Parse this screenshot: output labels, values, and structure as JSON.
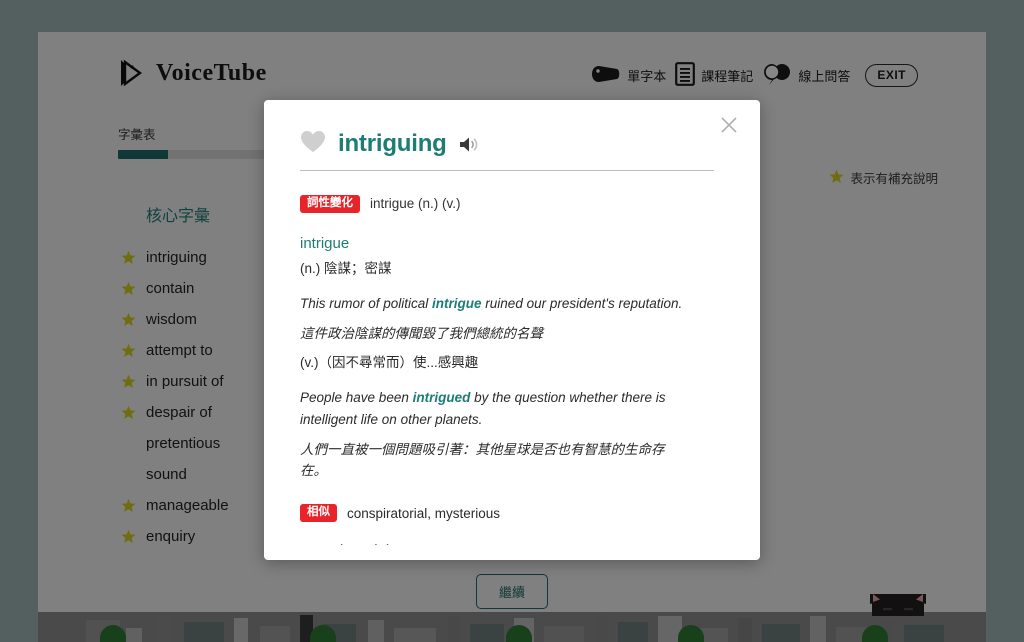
{
  "colors": {
    "page_backdrop": "#53605f",
    "accent_teal": "#1d7d75",
    "progress_teal": "#1d6b66",
    "tag_red": "#e8242a",
    "star_yellow": "#d4cf20"
  },
  "header": {
    "brand": "VoiceTube",
    "logo_icon": "voicetube-play-icon",
    "nav": [
      {
        "label": "單字本",
        "icon": "tag-icon"
      },
      {
        "label": "課程筆記",
        "icon": "document-icon"
      },
      {
        "label": "線上問答",
        "icon": "speech-bubbles-icon"
      }
    ],
    "exit_label": "EXIT"
  },
  "progress": {
    "label": "字彙表",
    "percent": 12
  },
  "legend": {
    "icon": "star-icon",
    "text": "表示有補充說明"
  },
  "vocab": {
    "heading": "核心字彙",
    "items": [
      {
        "word": "intriguing",
        "starred": true
      },
      {
        "word": "contain",
        "starred": true
      },
      {
        "word": "wisdom",
        "starred": true
      },
      {
        "word": "attempt to",
        "starred": true
      },
      {
        "word": "in pursuit of",
        "starred": true
      },
      {
        "word": "despair of",
        "starred": true
      },
      {
        "word": "pretentious",
        "starred": false
      },
      {
        "word": "sound",
        "starred": false
      },
      {
        "word": "manageable",
        "starred": true
      },
      {
        "word": "enquiry",
        "starred": true
      }
    ]
  },
  "continue_button": {
    "label": "繼續"
  },
  "modal": {
    "favorite_icon": "heart-icon",
    "word": "intriguing",
    "speaker_icon": "speaker-icon",
    "close_icon": "close-icon",
    "wordform": {
      "tag": "詞性變化",
      "text": "intrigue (n.) (v.)"
    },
    "entry": {
      "headword": "intrigue",
      "senses": [
        {
          "definition": "(n.) 陰謀；密謀",
          "example_en_before": "This rumor of political ",
          "example_en_highlight": "intrigue",
          "example_en_after": " ruined our president's reputation.",
          "example_zh": "這件政治陰謀的傳聞毀了我們總統的名聲"
        },
        {
          "definition": "(v.)（因不尋常而）使...感興趣",
          "example_en_before": "People have been ",
          "example_en_highlight": "intrigued",
          "example_en_after": " by the question whether there is intelligent life on other planets.",
          "example_zh": "人們一直被一個問題吸引著：其他星球是否也有智慧的生命存在。"
        }
      ]
    },
    "similar": {
      "tag": "相似",
      "text": "conspiratorial, mysterious",
      "next_word": "conspiratorial"
    }
  }
}
